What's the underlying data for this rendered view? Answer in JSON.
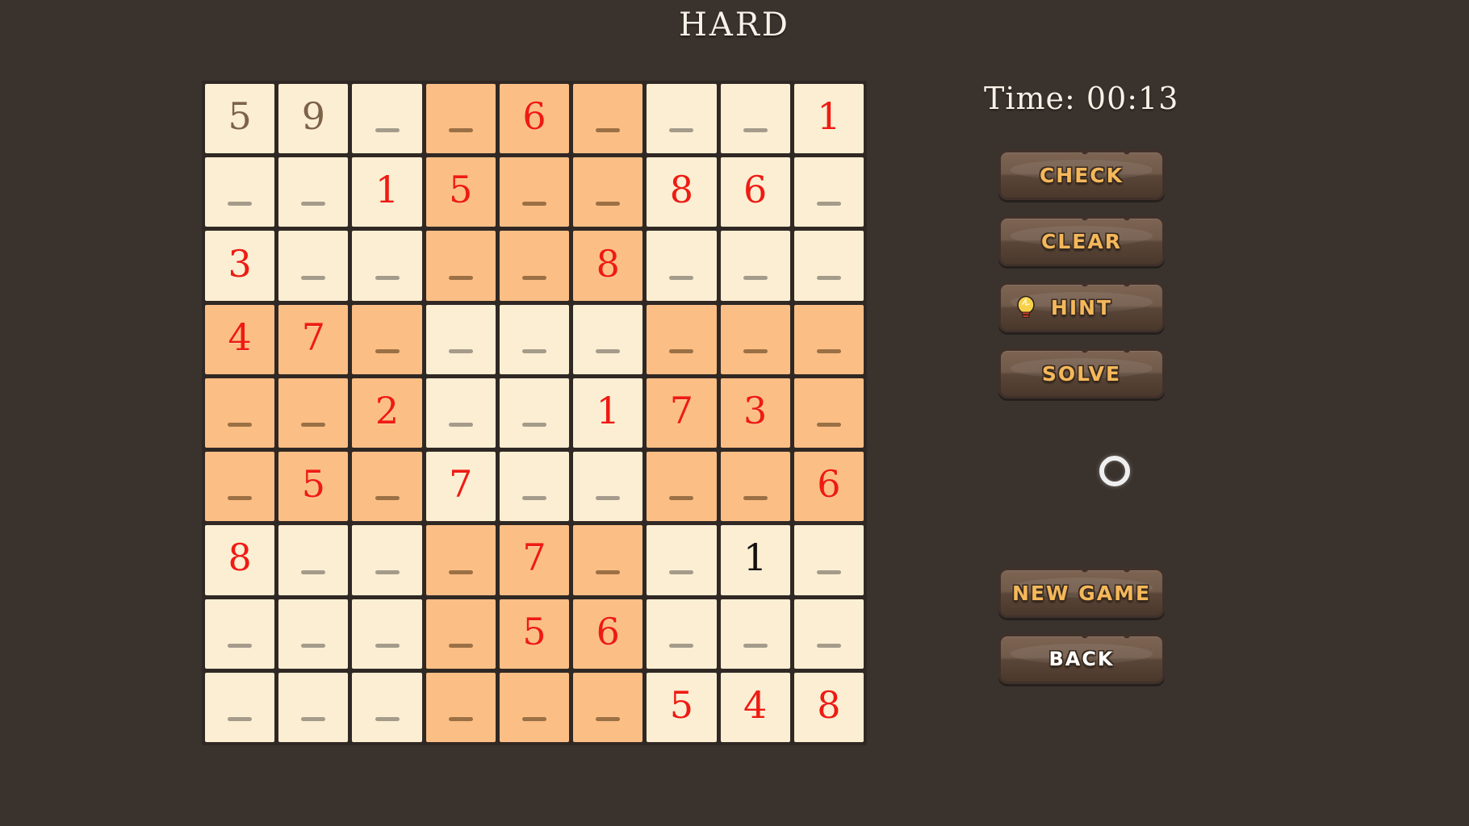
{
  "header": {
    "title": "HARD"
  },
  "panel": {
    "timer_label": "Time: 00:13",
    "buttons": [
      {
        "id": "check",
        "label": "CHECK",
        "style": "orange",
        "icon": null
      },
      {
        "id": "clear",
        "label": "CLEAR",
        "style": "orange",
        "icon": null
      },
      {
        "id": "hint",
        "label": "HINT",
        "style": "orange",
        "icon": "lightbulb-icon"
      },
      {
        "id": "solve",
        "label": "SOLVE",
        "style": "orange",
        "icon": null
      }
    ],
    "bottom_buttons": [
      {
        "id": "new-game",
        "label": "NEW GAME",
        "style": "orange",
        "icon": null
      },
      {
        "id": "back",
        "label": "BACK",
        "style": "white",
        "icon": null
      }
    ],
    "spinner": {
      "name": "loading-spinner",
      "color": "#efefef"
    }
  },
  "colors": {
    "background": "#3a322d",
    "cell_light": "#fbeed2",
    "cell_shaded": "#fbbe85",
    "grid_line": "#302824",
    "value_user": "#ee1b13",
    "value_given": "#7d6248",
    "value_black": "#141010",
    "button_text": "#f4b85b",
    "title_text": "#f7f2e8"
  },
  "board": {
    "size": 9,
    "empty_marker": "_",
    "rows": [
      [
        {
          "v": "5",
          "k": "given",
          "s": false
        },
        {
          "v": "9",
          "k": "given",
          "s": false
        },
        {
          "v": "",
          "k": "empty",
          "s": false
        },
        {
          "v": "",
          "k": "empty",
          "s": true
        },
        {
          "v": "6",
          "k": "user",
          "s": true
        },
        {
          "v": "",
          "k": "empty",
          "s": true
        },
        {
          "v": "",
          "k": "empty",
          "s": false
        },
        {
          "v": "",
          "k": "empty",
          "s": false
        },
        {
          "v": "1",
          "k": "user",
          "s": false
        }
      ],
      [
        {
          "v": "",
          "k": "empty",
          "s": false
        },
        {
          "v": "",
          "k": "empty",
          "s": false
        },
        {
          "v": "1",
          "k": "user",
          "s": false
        },
        {
          "v": "5",
          "k": "user",
          "s": true
        },
        {
          "v": "",
          "k": "empty",
          "s": true
        },
        {
          "v": "",
          "k": "empty",
          "s": true
        },
        {
          "v": "8",
          "k": "user",
          "s": false
        },
        {
          "v": "6",
          "k": "user",
          "s": false
        },
        {
          "v": "",
          "k": "empty",
          "s": false
        }
      ],
      [
        {
          "v": "3",
          "k": "user",
          "s": false
        },
        {
          "v": "",
          "k": "empty",
          "s": false
        },
        {
          "v": "",
          "k": "empty",
          "s": false
        },
        {
          "v": "",
          "k": "empty",
          "s": true
        },
        {
          "v": "",
          "k": "empty",
          "s": true
        },
        {
          "v": "8",
          "k": "user",
          "s": true
        },
        {
          "v": "",
          "k": "empty",
          "s": false
        },
        {
          "v": "",
          "k": "empty",
          "s": false
        },
        {
          "v": "",
          "k": "empty",
          "s": false
        }
      ],
      [
        {
          "v": "4",
          "k": "user",
          "s": true
        },
        {
          "v": "7",
          "k": "user",
          "s": true
        },
        {
          "v": "",
          "k": "empty",
          "s": true
        },
        {
          "v": "",
          "k": "empty",
          "s": false
        },
        {
          "v": "",
          "k": "empty",
          "s": false
        },
        {
          "v": "",
          "k": "empty",
          "s": false
        },
        {
          "v": "",
          "k": "empty",
          "s": true
        },
        {
          "v": "",
          "k": "empty",
          "s": true
        },
        {
          "v": "",
          "k": "empty",
          "s": true
        }
      ],
      [
        {
          "v": "",
          "k": "empty",
          "s": true
        },
        {
          "v": "",
          "k": "empty",
          "s": true
        },
        {
          "v": "2",
          "k": "user",
          "s": true
        },
        {
          "v": "",
          "k": "empty",
          "s": false
        },
        {
          "v": "",
          "k": "empty",
          "s": false
        },
        {
          "v": "1",
          "k": "user",
          "s": false
        },
        {
          "v": "7",
          "k": "user",
          "s": true
        },
        {
          "v": "3",
          "k": "user",
          "s": true
        },
        {
          "v": "",
          "k": "empty",
          "s": true
        }
      ],
      [
        {
          "v": "",
          "k": "empty",
          "s": true
        },
        {
          "v": "5",
          "k": "user",
          "s": true
        },
        {
          "v": "",
          "k": "empty",
          "s": true
        },
        {
          "v": "7",
          "k": "user",
          "s": false
        },
        {
          "v": "",
          "k": "empty",
          "s": false
        },
        {
          "v": "",
          "k": "empty",
          "s": false
        },
        {
          "v": "",
          "k": "empty",
          "s": true
        },
        {
          "v": "",
          "k": "empty",
          "s": true
        },
        {
          "v": "6",
          "k": "user",
          "s": true
        }
      ],
      [
        {
          "v": "8",
          "k": "user",
          "s": false
        },
        {
          "v": "",
          "k": "empty",
          "s": false
        },
        {
          "v": "",
          "k": "empty",
          "s": false
        },
        {
          "v": "",
          "k": "empty",
          "s": true
        },
        {
          "v": "7",
          "k": "user",
          "s": true
        },
        {
          "v": "",
          "k": "empty",
          "s": true
        },
        {
          "v": "",
          "k": "empty",
          "s": false
        },
        {
          "v": "1",
          "k": "black",
          "s": false
        },
        {
          "v": "",
          "k": "empty",
          "s": false
        }
      ],
      [
        {
          "v": "",
          "k": "empty",
          "s": false
        },
        {
          "v": "",
          "k": "empty",
          "s": false
        },
        {
          "v": "",
          "k": "empty",
          "s": false
        },
        {
          "v": "",
          "k": "empty",
          "s": true
        },
        {
          "v": "5",
          "k": "user",
          "s": true
        },
        {
          "v": "6",
          "k": "user",
          "s": true
        },
        {
          "v": "",
          "k": "empty",
          "s": false
        },
        {
          "v": "",
          "k": "empty",
          "s": false
        },
        {
          "v": "",
          "k": "empty",
          "s": false
        }
      ],
      [
        {
          "v": "",
          "k": "empty",
          "s": false
        },
        {
          "v": "",
          "k": "empty",
          "s": false
        },
        {
          "v": "",
          "k": "empty",
          "s": false
        },
        {
          "v": "",
          "k": "empty",
          "s": true
        },
        {
          "v": "",
          "k": "empty",
          "s": true
        },
        {
          "v": "",
          "k": "empty",
          "s": true
        },
        {
          "v": "5",
          "k": "user",
          "s": false
        },
        {
          "v": "4",
          "k": "user",
          "s": false
        },
        {
          "v": "8",
          "k": "user",
          "s": false
        }
      ]
    ]
  }
}
